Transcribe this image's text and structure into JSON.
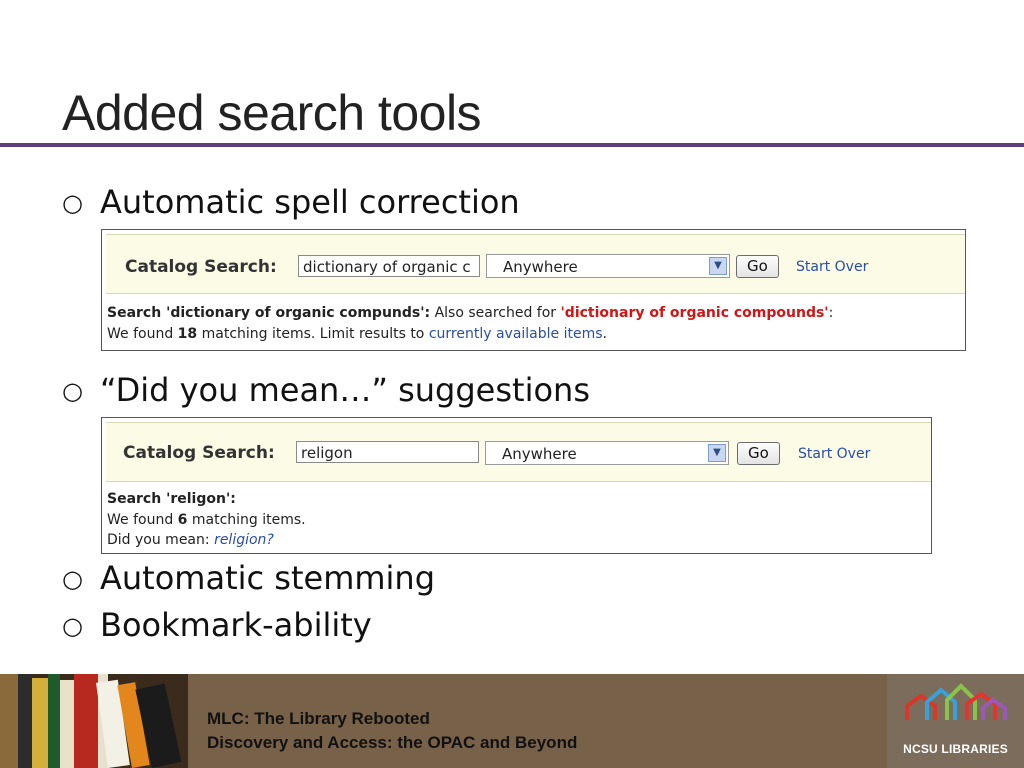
{
  "slide": {
    "title": "Added search tools",
    "bullet_mark": "○",
    "bullets": [
      "Automatic spell correction",
      "“Did you mean…” suggestions",
      "Automatic stemming",
      "Bookmark-ability"
    ]
  },
  "screenshot1": {
    "catalog_label": "Catalog Search:",
    "search_value": "dictionary of organic c",
    "scope_selected": "Anywhere",
    "go_label": "Go",
    "start_over_label": "Start Over",
    "line1_prefix": "Search 'dictionary of organic compunds':",
    "line1_middle": " Also searched for ",
    "line1_highlight": "'dictionary of organic compounds'",
    "line1_suffix": ":",
    "line2_prefix": "We found ",
    "line2_count": "18",
    "line2_middle": " matching items. Limit results to ",
    "line2_link": "currently available items",
    "line2_suffix": "."
  },
  "screenshot2": {
    "catalog_label": "Catalog Search:",
    "search_value": "religon",
    "scope_selected": "Anywhere",
    "go_label": "Go",
    "start_over_label": "Start Over",
    "line1": "Search 'religon':",
    "line2_prefix": "We found ",
    "line2_count": "6",
    "line2_suffix": " matching items.",
    "line3_prefix": "Did you mean: ",
    "line3_link": "religion?"
  },
  "footer": {
    "line1": "MLC: The Library Rebooted",
    "line2": "Discovery and Access: the OPAC and Beyond",
    "logo_text": "NCSU LIBRARIES"
  },
  "colors": {
    "title_rule": "#5b3d7c",
    "footer_band": "#786149",
    "highlight": "#d21414",
    "link": "#2a4ea6"
  }
}
